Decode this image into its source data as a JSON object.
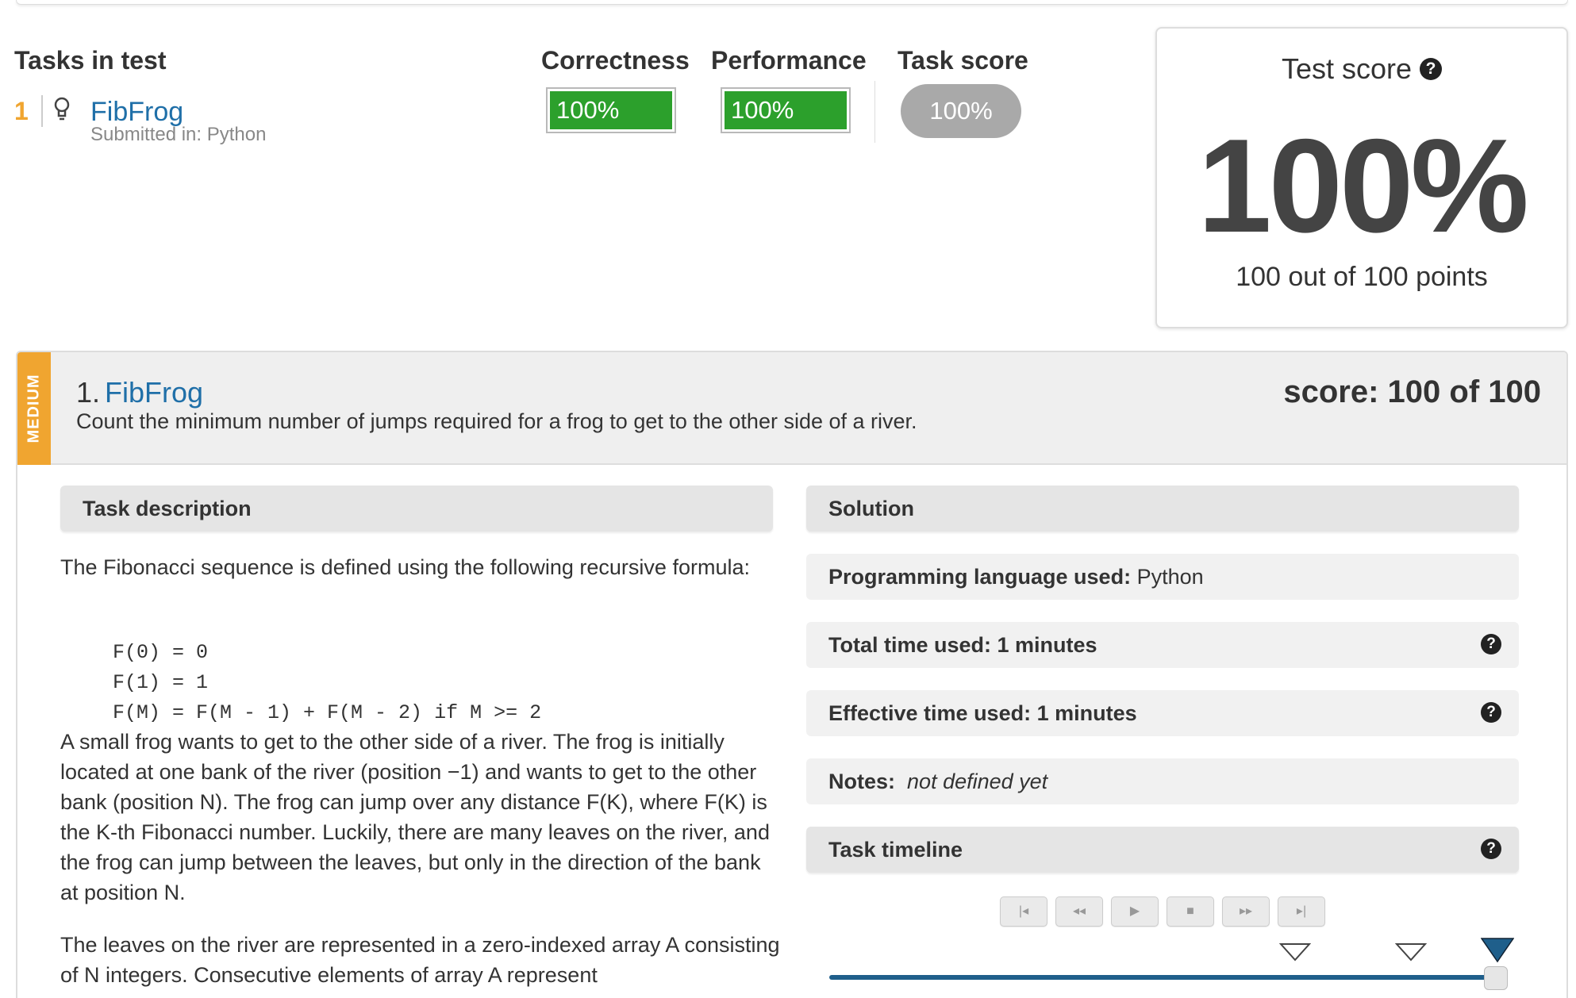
{
  "summary": {
    "tasks_header": "Tasks in test",
    "correctness_header": "Correctness",
    "performance_header": "Performance",
    "task_score_header": "Task score",
    "task": {
      "number": "1",
      "name": "FibFrog",
      "submitted": "Submitted in: Python",
      "correctness": "100%",
      "performance": "100%",
      "task_score": "100%"
    }
  },
  "test_score": {
    "title": "Test score",
    "help": "?",
    "value": "100%",
    "points": "100 out of 100 points"
  },
  "task_panel": {
    "difficulty": "MEDIUM",
    "number": "1.",
    "name": "FibFrog",
    "summary": "Count the minimum number of jumps required for a frog to get to the other side of a river.",
    "score": "score: 100 of 100",
    "accent_color": "#f0a530"
  },
  "description": {
    "header": "Task description",
    "intro": "The Fibonacci sequence is defined using the following recursive formula:",
    "code": [
      "F(0) = 0",
      "F(1) = 1",
      "F(M) = F(M - 1) + F(M - 2) if M >= 2"
    ],
    "paragraph1": "A small frog wants to get to the other side of a river. The frog is initially located at one bank of the river (position −1) and wants to get to the other bank (position N). The frog can jump over any distance F(K), where F(K) is the K-th Fibonacci number. Luckily, there are many leaves on the river, and the frog can jump between the leaves, but only in the direction of the bank at position N.",
    "paragraph2": "The leaves on the river are represented in a zero-indexed array A consisting of N integers. Consecutive elements of array A represent"
  },
  "solution": {
    "header": "Solution",
    "language_label": "Programming language used:",
    "language_value": "Python",
    "total_time": "Total time used: 1 minutes",
    "effective_time": "Effective time used: 1 minutes",
    "notes_label": "Notes:",
    "notes_value": "not defined yet",
    "timeline_header": "Task timeline",
    "controls": [
      "|◂",
      "◂◂",
      "▶",
      "■",
      "▸▸",
      "▸|"
    ],
    "timeline_progress": 1.0
  },
  "colors": {
    "link": "#1f6fa8",
    "success": "#2ca02c",
    "timeline": "#1f5f8b"
  }
}
